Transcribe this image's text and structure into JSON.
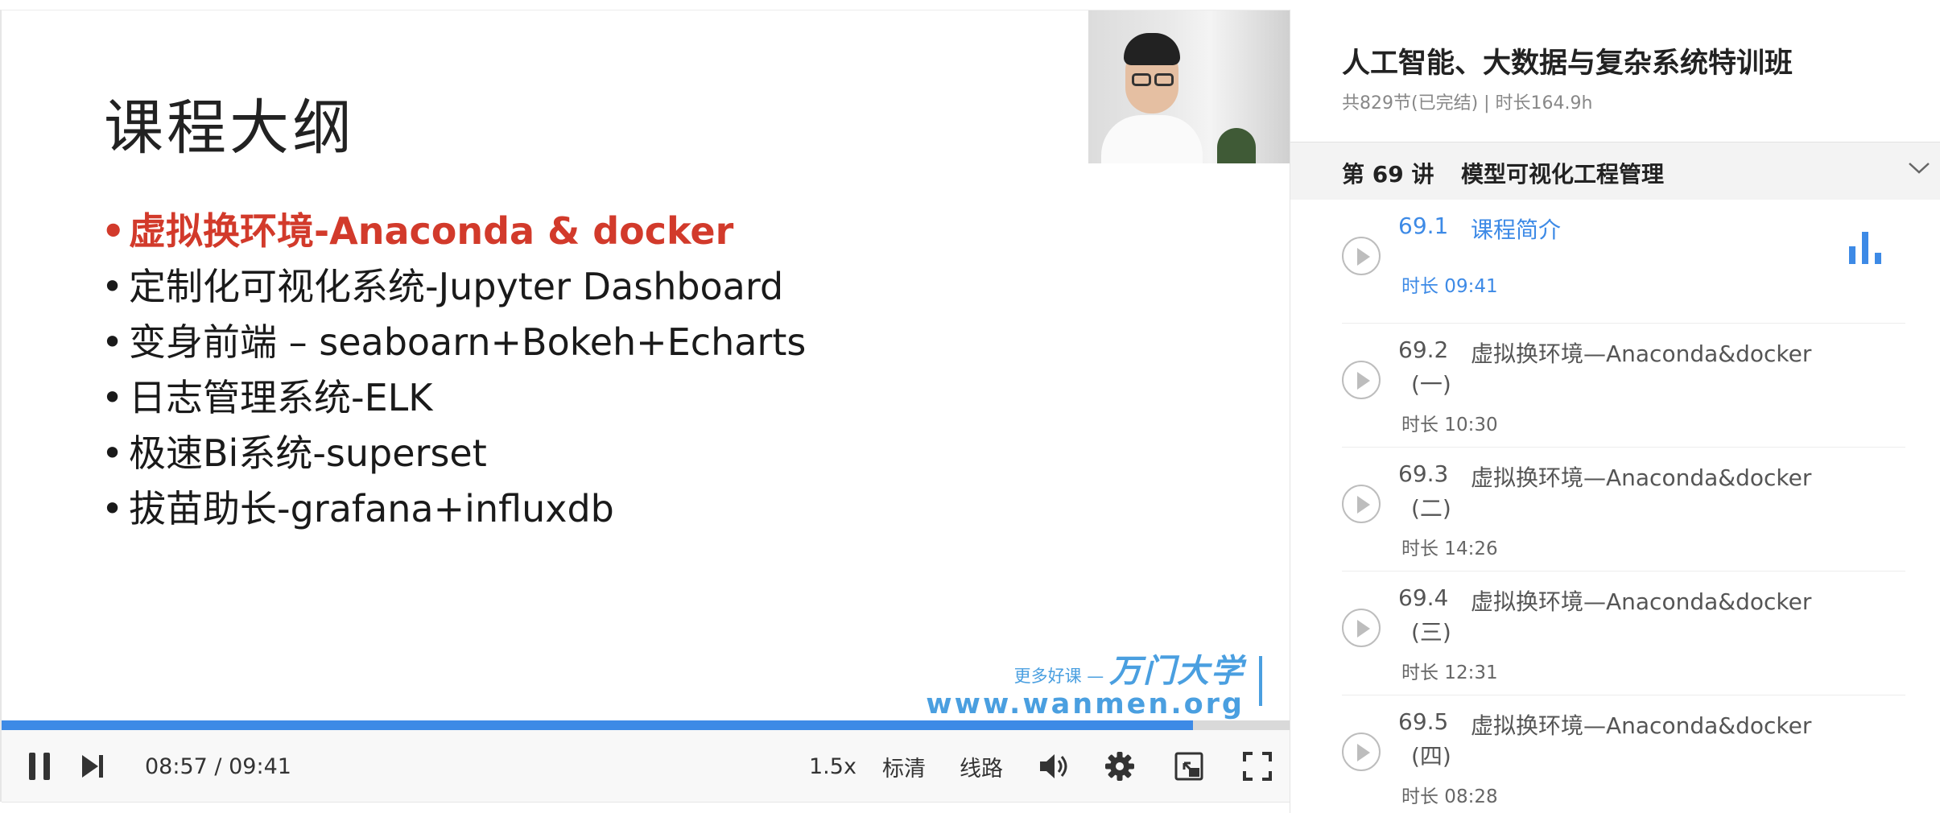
{
  "player": {
    "slide_title": "课程大纲",
    "bullets": [
      "虚拟换环境-Anaconda & docker",
      "定制化可视化系统-Jupyter Dashboard",
      "变身前端 – seaboarn+Bokeh+Echarts",
      "日志管理系统-ELK",
      "极速Bi系统-superset",
      "拔苗助长-grafana+influxdb"
    ],
    "bullet_symbol": "•",
    "watermark": {
      "tagline": "更多好课 —",
      "brand": "万门大学",
      "url": "www.wanmen.org"
    },
    "progress_fraction": 0.924,
    "current_time": "08:57",
    "time_separator": "/",
    "total_time": "09:41",
    "speed": "1.5x",
    "quality": "标清",
    "route": "线路",
    "icons": {
      "pause": "pause-icon",
      "next": "next-icon",
      "volume": "volume-icon",
      "settings": "gear-icon",
      "mini": "picture-in-picture-icon",
      "fullscreen": "fullscreen-icon"
    },
    "colors": {
      "accent": "#3d8ae6",
      "highlight": "#d23a2b"
    }
  },
  "sidebar": {
    "course_title": "人工智能、大数据与复杂系统特训班",
    "course_meta": "共829节(已完结) | 时长164.9h",
    "chapter": {
      "label": "第 69 讲",
      "title": "模型可视化工程管理"
    },
    "lessons": [
      {
        "number": "69.1",
        "title": "课程简介",
        "subtitle": "",
        "duration": "时长 09:41",
        "active": true
      },
      {
        "number": "69.2",
        "title": "虚拟换环境—Anaconda&docker",
        "subtitle": "(一)",
        "duration": "时长 10:30",
        "active": false
      },
      {
        "number": "69.3",
        "title": "虚拟换环境—Anaconda&docker",
        "subtitle": "(二)",
        "duration": "时长 14:26",
        "active": false
      },
      {
        "number": "69.4",
        "title": "虚拟换环境—Anaconda&docker",
        "subtitle": "(三)",
        "duration": "时长 12:31",
        "active": false
      },
      {
        "number": "69.5",
        "title": "虚拟换环境—Anaconda&docker",
        "subtitle": "(四)",
        "duration": "时长 08:28",
        "active": false
      }
    ]
  }
}
